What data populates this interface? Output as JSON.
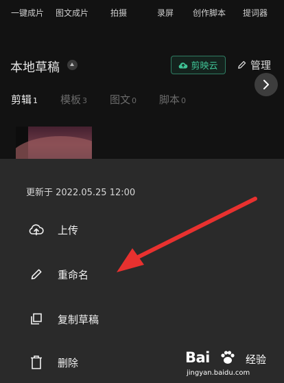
{
  "shortcuts": [
    "一键成片",
    "图文成片",
    "拍摄",
    "录屏",
    "创作脚本",
    "提词器"
  ],
  "drafts": {
    "title": "本地草稿",
    "cloud_label": "剪映云",
    "manage_label": "管理"
  },
  "tabs": [
    {
      "label": "剪辑",
      "count": "1",
      "active": true
    },
    {
      "label": "模板",
      "count": "3",
      "active": false
    },
    {
      "label": "图文",
      "count": "0",
      "active": false
    },
    {
      "label": "脚本",
      "count": "0",
      "active": false
    }
  ],
  "sheet": {
    "updated": "更新于 2022.05.25 12:00",
    "items": [
      {
        "label": "上传",
        "icon": "cloud-upload-icon"
      },
      {
        "label": "重命名",
        "icon": "pencil-icon"
      },
      {
        "label": "复制草稿",
        "icon": "copy-icon"
      },
      {
        "label": "删除",
        "icon": "trash-icon"
      }
    ]
  },
  "watermark": {
    "brand": "Bai",
    "jingyan": "经验",
    "url": "jingyan.baidu.com"
  },
  "colors": {
    "accent": "#3fc496",
    "annotation_arrow": "#e8312f",
    "sheet_bg": "#2a2a2a",
    "page_bg": "#121212"
  }
}
